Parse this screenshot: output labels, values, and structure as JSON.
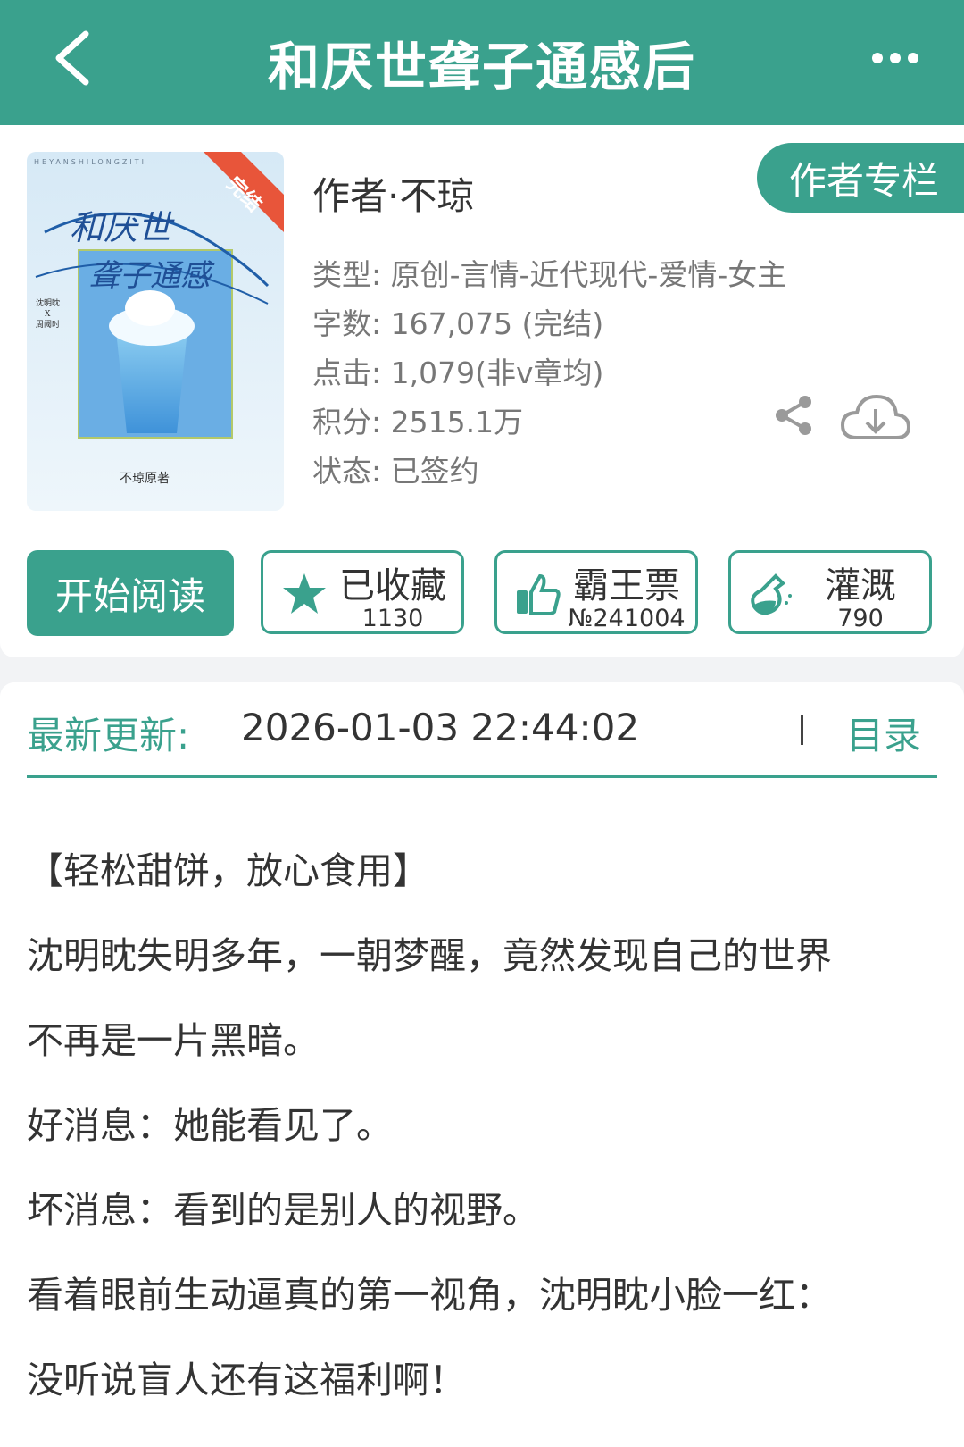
{
  "header": {
    "title": "和厌世聋子通感后",
    "back_icon": "chevron-left-icon",
    "more_icon": "ellipsis-icon"
  },
  "book": {
    "cover": {
      "badge": "完结",
      "pinyin": "HEYANSHILONGZITI",
      "title_art": "和厌世聋子通感",
      "names": "沈明眈 X 周阈时",
      "publisher": "不琼原著"
    },
    "author_label": "作者·不琼",
    "author_column_button": "作者专栏",
    "meta": {
      "type": "类型: 原创-言情-近代现代-爱情-女主",
      "words": "字数: 167,075 (完结)",
      "clicks": "点击: 1,079(非v章均)",
      "score": "积分: 2515.1万",
      "status": "状态: 已签约"
    },
    "share_icon": "share-icon",
    "download_icon": "cloud-download-icon"
  },
  "actions": {
    "start_reading": "开始阅读",
    "favorite": {
      "label": "已收藏",
      "count": "1130",
      "icon": "star-icon"
    },
    "ticket": {
      "label": "霸王票",
      "count": "№241004",
      "icon": "thumbs-up-icon"
    },
    "water": {
      "label": "灌溉",
      "count": "790",
      "icon": "watering-flask-icon"
    }
  },
  "update": {
    "label": "最新更新:",
    "time": "2026-01-03 22:44:02",
    "toc": "目录"
  },
  "description": [
    "【轻松甜饼，放心食用】",
    "沈明眈失明多年，一朝梦醒，竟然发现自己的世界",
    "不再是一片黑暗。",
    "好消息：她能看见了。",
    "坏消息：看到的是别人的视野。",
    "看着眼前生动逼真的第一视角，沈明眈小脸一红：",
    "没听说盲人还有这福利啊！"
  ],
  "colors": {
    "accent": "#3aa18d",
    "background": "#f2f3f5",
    "badge": "#e8553a"
  }
}
